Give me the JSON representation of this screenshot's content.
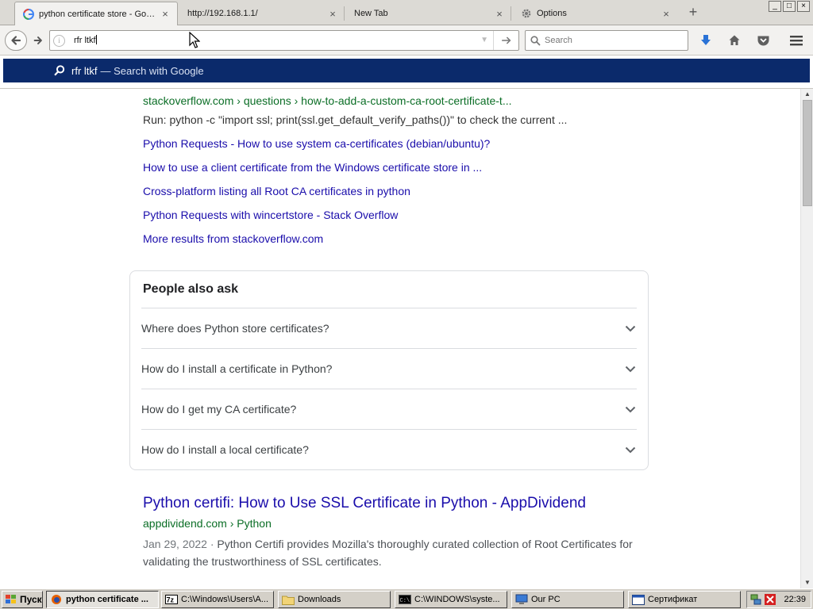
{
  "tabs": [
    {
      "label": "python certificate store - Goo...",
      "icon": "google-icon",
      "active": true
    },
    {
      "label": "http://192.168.1.1/",
      "icon": "none",
      "active": false
    },
    {
      "label": "New Tab",
      "icon": "none",
      "active": false
    },
    {
      "label": "Options",
      "icon": "gear-icon",
      "active": false
    }
  ],
  "new_tab_symbol": "+",
  "window_buttons": [
    "_",
    "□",
    "×"
  ],
  "address_bar": {
    "value": "rfr ltkf"
  },
  "search_box": {
    "placeholder": "Search"
  },
  "autocomplete": {
    "query": "rfr ltkf",
    "suffix": "— Search with Google"
  },
  "results": {
    "first": {
      "breadcrumb": "stackoverflow.com › questions › how-to-add-a-custom-ca-root-certificate-t...",
      "snippet": "Run: python -c \"import ssl; print(ssl.get_default_verify_paths())\" to check the current ...",
      "sublinks": [
        "Python Requests - How to use system ca-certificates (debian/ubuntu)?",
        "How to use a client certificate from the Windows certificate store in ...",
        "Cross-platform listing all Root CA certificates in python",
        "Python Requests with wincertstore - Stack Overflow",
        "More results from stackoverflow.com"
      ]
    },
    "people_also_ask": {
      "title": "People also ask",
      "questions": [
        "Where does Python store certificates?",
        "How do I install a certificate in Python?",
        "How do I get my CA certificate?",
        "How do I install a local certificate?"
      ]
    },
    "second": {
      "title": "Python certifi: How to Use SSL Certificate in Python - AppDividend",
      "breadcrumb": "appdividend.com › Python",
      "date": "Jan 29, 2022",
      "separator": " · ",
      "snippet": "Python Certifi provides Mozilla's thoroughly curated collection of Root Certificates for validating the trustworthiness of SSL certificates."
    }
  },
  "taskbar": {
    "start_label": "Пуск",
    "buttons": [
      {
        "label": "python certificate ...",
        "icon": "firefox-icon",
        "pressed": true
      },
      {
        "label": "C:\\Windows\\Users\\A...",
        "icon": "7zip-icon",
        "pressed": false
      },
      {
        "label": "Downloads",
        "icon": "folder-icon",
        "pressed": false
      },
      {
        "label": "C:\\WINDOWS\\syste...",
        "icon": "console-icon",
        "pressed": false
      },
      {
        "label": "Our PC",
        "icon": "computer-icon",
        "pressed": false
      },
      {
        "label": "Сертификат",
        "icon": "window-icon",
        "pressed": false
      }
    ],
    "clock": "22:39"
  },
  "colors": {
    "autocomplete_highlight": "#0b2a6b",
    "link": "#1a0dab",
    "url_green": "#0b6e26",
    "download_blue": "#2a72d6"
  }
}
